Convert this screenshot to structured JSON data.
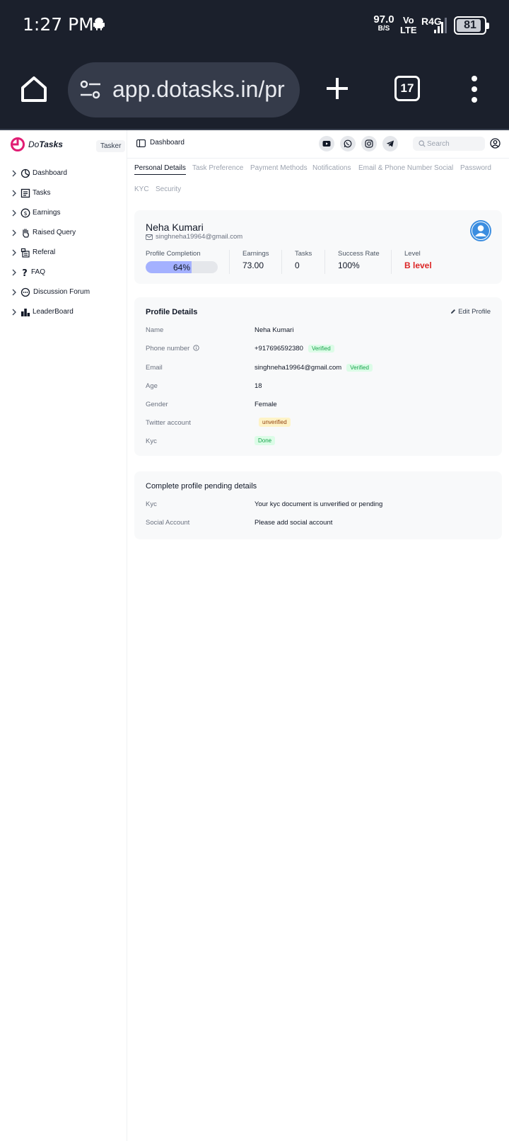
{
  "status_bar": {
    "time": "1:27 PM",
    "net_speed_value": "97.0",
    "net_speed_unit": "B/S",
    "volte_top": "Vo",
    "volte_bottom": "LTE",
    "network": "R4G",
    "battery": "81"
  },
  "browser": {
    "url": "app.dotasks.in/pr",
    "tab_count": "17"
  },
  "sidebar": {
    "logo_do": "Do",
    "logo_tasks": "Tasks",
    "role": "Tasker",
    "items": [
      {
        "label": "Dashboard",
        "icon": "dashboard-icon"
      },
      {
        "label": "Tasks",
        "icon": "tasks-icon"
      },
      {
        "label": "Earnings",
        "icon": "earnings-icon"
      },
      {
        "label": "Raised Query",
        "icon": "raised-hand-icon"
      },
      {
        "label": "Referal",
        "icon": "referral-icon"
      },
      {
        "label": "FAQ",
        "icon": "question-icon"
      },
      {
        "label": "Discussion Forum",
        "icon": "forum-icon"
      },
      {
        "label": "LeaderBoard",
        "icon": "leaderboard-icon"
      }
    ]
  },
  "topbar": {
    "title": "Dashboard",
    "search_placeholder": "Search",
    "social": [
      "youtube-icon",
      "whatsapp-icon",
      "instagram-icon",
      "telegram-icon"
    ]
  },
  "tabs": [
    "Personal Details",
    "Task Preference",
    "Payment Methods",
    "Notifications",
    "Email & Phone Number",
    "Social",
    "Password",
    "KYC",
    "Security"
  ],
  "active_tab": "Personal Details",
  "profile": {
    "name": "Neha Kumari",
    "email": "singhneha19964@gmail.com",
    "completion_label": "Profile Completion",
    "completion_value": "64%",
    "completion_fraction": 0.64,
    "stats": [
      {
        "label": "Earnings",
        "value": "73.00"
      },
      {
        "label": "Tasks",
        "value": "0"
      },
      {
        "label": "Success Rate",
        "value": "100%"
      },
      {
        "label": "Level",
        "value": "B level"
      }
    ]
  },
  "details": {
    "title": "Profile Details",
    "edit_label": "Edit Profile",
    "rows": [
      {
        "label": "Name",
        "value": "Neha Kumari"
      },
      {
        "label": "Phone number",
        "value": "+917696592380",
        "badge": "Verified"
      },
      {
        "label": "Email",
        "value": "singhneha19964@gmail.com",
        "badge": "Verified"
      },
      {
        "label": "Age",
        "value": "18"
      },
      {
        "label": "Gender",
        "value": "Female"
      },
      {
        "label": "Twitter account",
        "badge": "unverified"
      },
      {
        "label": "Kyc",
        "badge": "Done"
      }
    ]
  },
  "pending": {
    "title": "Complete profile pending details",
    "rows": [
      {
        "label": "Kyc",
        "value": "Your kyc document is unverified or pending"
      },
      {
        "label": "Social Account",
        "value": "Please add social account"
      }
    ]
  },
  "colors": {
    "chrome_bg": "#1b202c",
    "brand": "#e11d74",
    "progress_fill": "#a4b1ff",
    "level": "#dc2626",
    "verified": "#16a34a"
  }
}
